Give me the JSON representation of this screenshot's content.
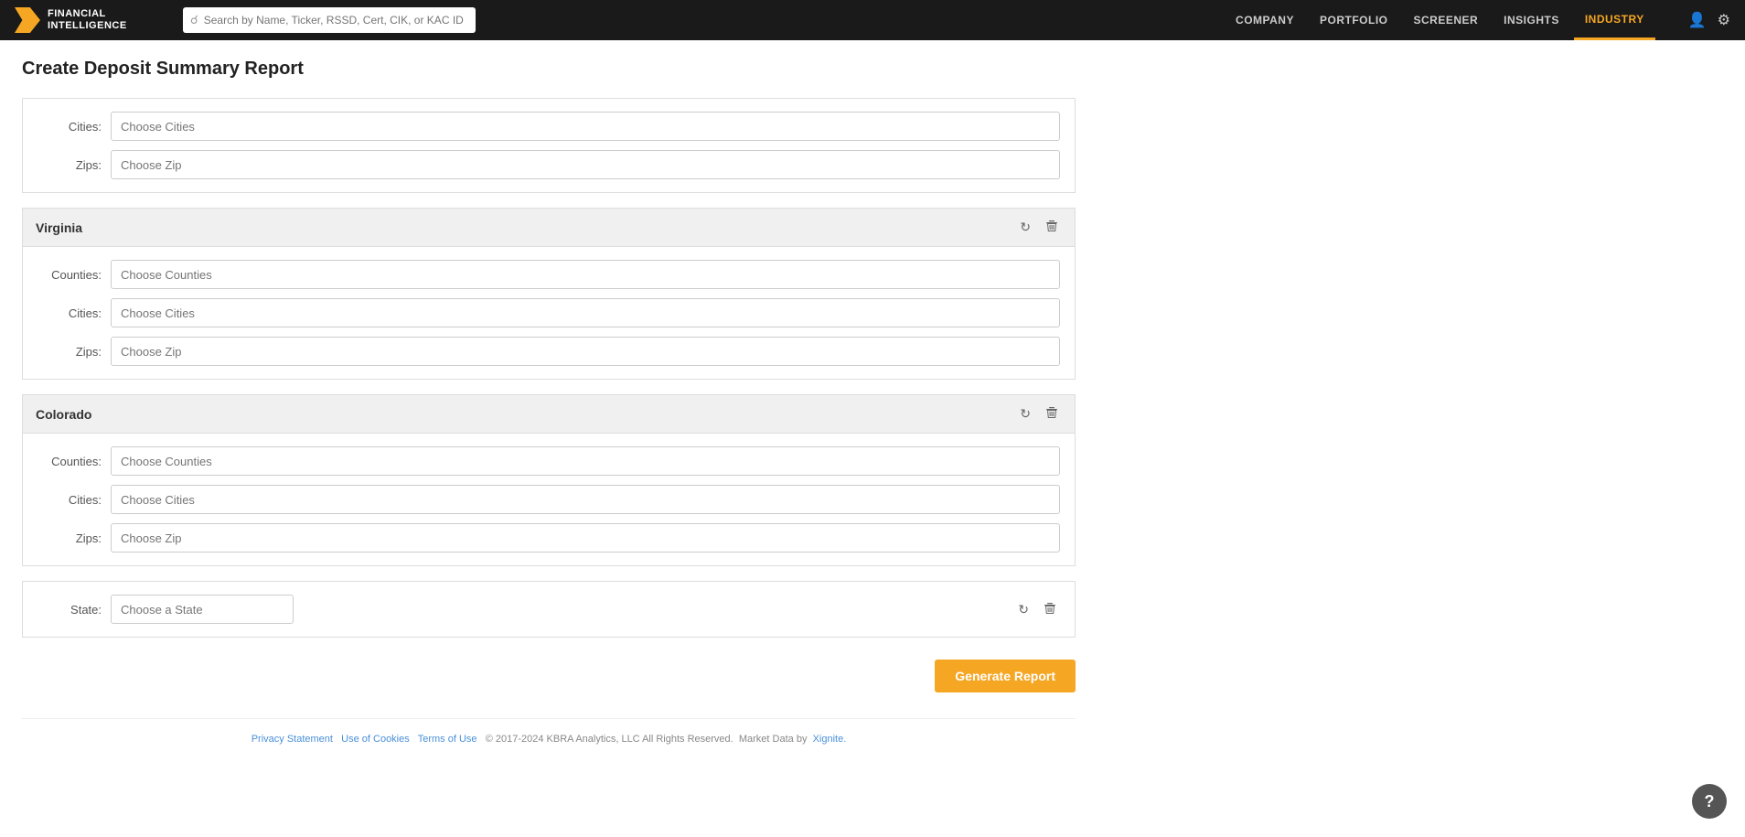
{
  "app": {
    "logo_line1": "FINANCIAL",
    "logo_line2": "INTELLIGENCE"
  },
  "nav": {
    "search_placeholder": "Search by Name, Ticker, RSSD, Cert, CIK, or KAC ID",
    "links": [
      {
        "label": "COMPANY",
        "active": false
      },
      {
        "label": "PORTFOLIO",
        "active": false
      },
      {
        "label": "SCREENER",
        "active": false
      },
      {
        "label": "INSIGHTS",
        "active": false
      },
      {
        "label": "INDUSTRY",
        "active": true
      }
    ]
  },
  "page": {
    "title": "Create Deposit Summary Report"
  },
  "partial_section": {
    "cities_placeholder": "Choose Cities",
    "zips_placeholder": "Choose Zip",
    "cities_label": "Cities:",
    "zips_label": "Zips:"
  },
  "virginia_section": {
    "name": "Virginia",
    "counties_label": "Counties:",
    "cities_label": "Cities:",
    "zips_label": "Zips:",
    "counties_placeholder": "Choose Counties",
    "cities_placeholder": "Choose Cities",
    "zips_placeholder": "Choose Zip"
  },
  "colorado_section": {
    "name": "Colorado",
    "counties_label": "Counties:",
    "cities_label": "Cities:",
    "zips_label": "Zips:",
    "counties_placeholder": "Choose Counties",
    "cities_placeholder": "Choose Cities",
    "zips_placeholder": "Choose Zip"
  },
  "add_state_row": {
    "state_label": "State:",
    "state_placeholder": "Choose a State"
  },
  "buttons": {
    "generate": "Generate Report",
    "refresh": "↻",
    "delete": "🗑"
  },
  "footer": {
    "privacy": "Privacy Statement",
    "cookies": "Use of Cookies",
    "terms": "Terms of Use",
    "copyright": "© 2017-2024 KBRA Analytics, LLC All Rights Reserved.",
    "market_data": "Market Data by",
    "xignite": "Xignite."
  },
  "help": {
    "label": "?"
  }
}
